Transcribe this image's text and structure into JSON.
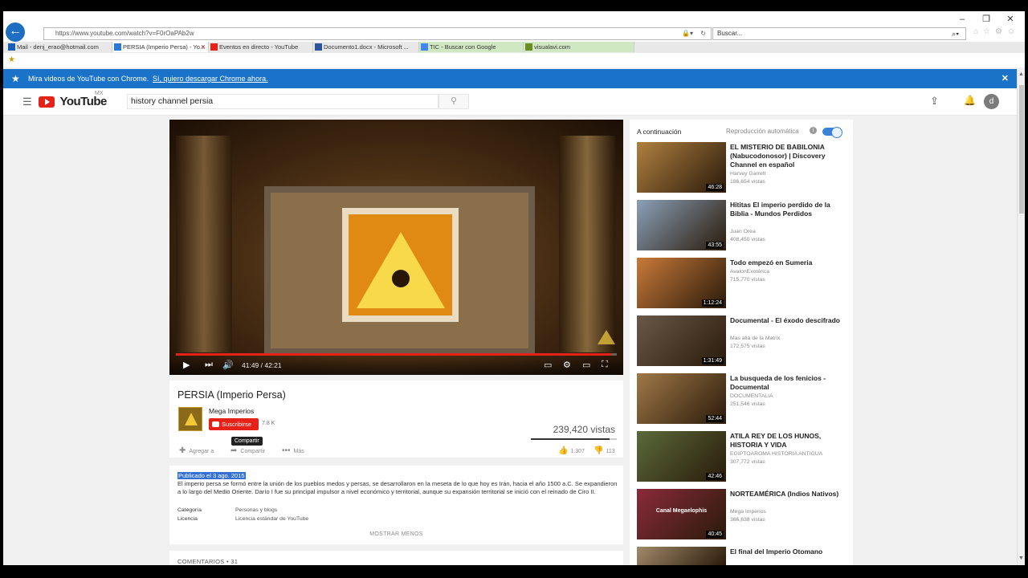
{
  "browser": {
    "url": "https://www.youtube.com/watch?v=F0rOaPAb2w",
    "search_placeholder": "Buscar...",
    "tabs": [
      {
        "label": "Mail - denj_erao@hotmail.com",
        "icon": "mail-icon",
        "color": "#1a5fb4"
      },
      {
        "label": "PERSIA (Imperio Persa) - Yo...",
        "icon": "ie-tab-icon",
        "color": "#2a7ad6",
        "active": true
      },
      {
        "label": "Eventos en directo - YouTube",
        "icon": "youtube-tab-icon",
        "color": "#e62117"
      },
      {
        "label": "Documento1.docx - Microsoft ...",
        "icon": "word-icon",
        "color": "#2b579a"
      },
      {
        "label": "TIC - Buscar con Google",
        "icon": "google-icon",
        "color": "#4285f4",
        "green": true
      },
      {
        "label": "visualavi.com",
        "icon": "site-icon",
        "color": "#6b8e23",
        "green": true
      }
    ]
  },
  "banner": {
    "message": "Mira videos de YouTube con Chrome.",
    "link": "Sí, quiero descargar Chrome ahora."
  },
  "yt": {
    "logo_text": "YouTube",
    "region": "MX",
    "search_query": "history channel persia",
    "avatar_letter": "d"
  },
  "player": {
    "time": "41:49 / 42:21",
    "progress_fraction": 0.987
  },
  "video": {
    "title": "PERSIA (Imperio Persa)",
    "channel": "Mega Imperios",
    "subscribe_label": "Suscribirse",
    "subscriber_count": "7.8 K",
    "tooltip": "Compartir",
    "views": "239,420 vistas",
    "likes_fraction": 0.92,
    "actions": {
      "add": "Agregar a",
      "share": "Compartir",
      "more": "Más"
    },
    "likes": "1.307",
    "dislikes": "113"
  },
  "description": {
    "published": "Publicado el 3 ago. 2015",
    "text": "El imperio persa se formó entre la unión de los pueblos medos y persas, se desarrollaron en la meseta de lo que hoy es Irán, hacia el año 1500 a.C. Se expandieron a lo largo del Medio Oriente. Darío I fue su principal impulsor a nivel económico y territorial, aunque su expansión territorial se inició con el reinado de Ciro II.",
    "category_label": "Categoría",
    "category_value": "Personas y blogs",
    "license_label": "Licencia",
    "license_value": "Licencia estándar de YouTube",
    "show_less": "MOSTRAR MENOS"
  },
  "comments": {
    "label": "COMENTARIOS • 31"
  },
  "sidebar": {
    "next_label": "A continuación",
    "autoplay_label": "Reproducción automática",
    "items": [
      {
        "title": "EL MISTERIO DE BABILONIA (Nabucodonosor) | Discovery Channel en español",
        "channel": "Harvey Garrett",
        "views": "186,654 vistas",
        "duration": "46:28",
        "thumb": "#b08040"
      },
      {
        "title": "Hititas El imperio perdido de la Biblia - Mundos Perdidos",
        "channel": "Juan Orea",
        "views": "408,450 vistas",
        "duration": "43:55",
        "thumb": "#8aa0b8"
      },
      {
        "title": "Todo empezó en Sumeria",
        "channel": "AvalonExotérica",
        "views": "715,770 vistas",
        "duration": "1:12:24",
        "thumb": "#c97a3a"
      },
      {
        "title": "Documental - El éxodo descifrado",
        "channel": "Mas allá de la Matrix",
        "views": "172,575 vistas",
        "duration": "1:31:49",
        "thumb": "#6a5848"
      },
      {
        "title": "La busqueda de los fenicios - Documental",
        "channel": "DOCUMENTALIA",
        "views": "251,546 vistas",
        "duration": "52:44",
        "thumb": "#a07848"
      },
      {
        "title": "ATILA REY DE LOS HUNOS, HISTORIA Y VIDA",
        "channel": "EGIPTOAROMA HISTORIA ANTIGUA",
        "views": "307,772 vistas",
        "duration": "42:46",
        "thumb": "#5a6a3a"
      },
      {
        "title": "NORTEAMÉRICA (Indios Nativos)",
        "channel": "Mega Imperios",
        "views": "366,638 vistas",
        "duration": "40:45",
        "thumb": "#8a2a3a",
        "overlay": "Canal Megaelophis"
      },
      {
        "title": "El final del Imperio Otomano",
        "channel": "",
        "views": "",
        "duration": "",
        "thumb": "#a08a6a"
      }
    ]
  }
}
